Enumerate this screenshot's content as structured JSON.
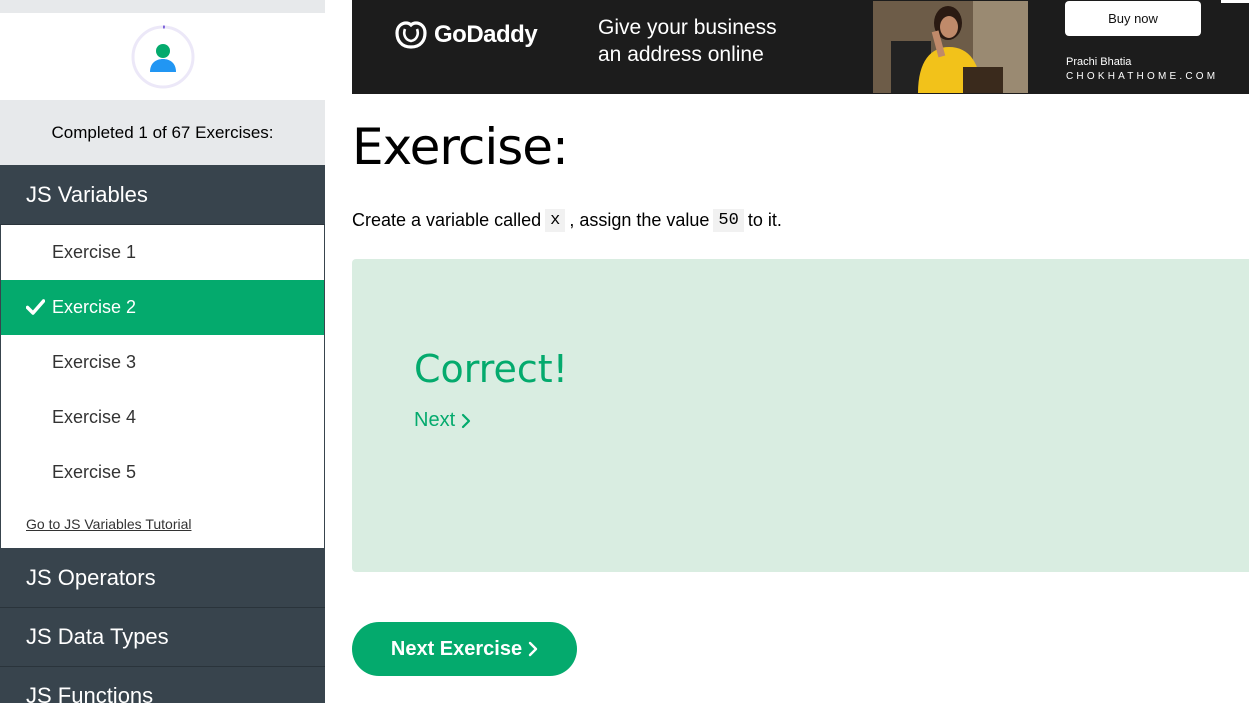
{
  "sidebar": {
    "progress_text": "Completed 1 of 67 Exercises:",
    "active_section": {
      "title": "JS Variables",
      "exercises": [
        {
          "label": "Exercise 1",
          "done": false
        },
        {
          "label": "Exercise 2",
          "done": true
        },
        {
          "label": "Exercise 3",
          "done": false
        },
        {
          "label": "Exercise 4",
          "done": false
        },
        {
          "label": "Exercise 5",
          "done": false
        }
      ],
      "tutorial_link": "Go to JS Variables Tutorial"
    },
    "other_sections": [
      "JS Operators",
      "JS Data Types",
      "JS Functions"
    ]
  },
  "ad": {
    "brand": "GoDaddy",
    "tagline_line1": "Give your business",
    "tagline_line2": "an address online",
    "button": "Buy now",
    "person": "Prachi Bhatia",
    "site": "CHOKHATHOME.COM"
  },
  "main": {
    "title": "Exercise:",
    "instruction_part1": "Create a variable called",
    "code1": "x",
    "instruction_part2": ", assign the value",
    "code2": "50",
    "instruction_part3": "to it.",
    "result_title": "Correct!",
    "next_link": "Next",
    "next_exercise_button": "Next Exercise"
  },
  "colors": {
    "accent": "#04aa6d",
    "sidebar_dark": "#38444d",
    "result_bg": "#d9ede1",
    "ad_bg": "#1c1c1c"
  },
  "icons": {
    "check": "check-icon",
    "chevron": "chevron-right-icon",
    "user": "user-avatar-icon",
    "brand_logo": "godaddy-logo-icon"
  }
}
